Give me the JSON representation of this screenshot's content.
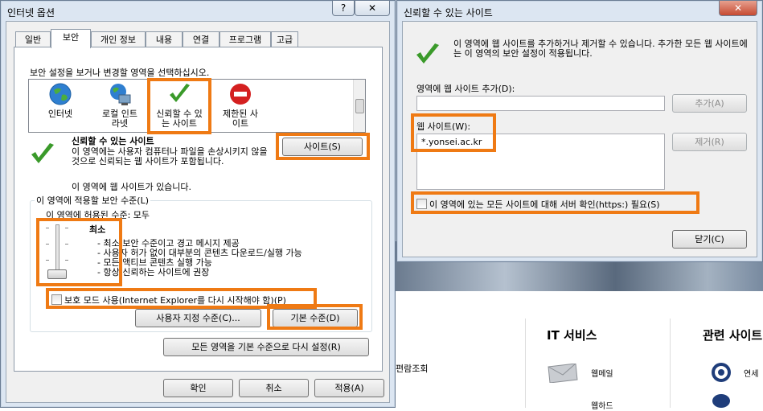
{
  "dialog1": {
    "title": "인터넷 옵션",
    "help_btn": "?",
    "close_btn": "✕",
    "tabs": [
      "일반",
      "보안",
      "개인 정보",
      "내용",
      "연결",
      "프로그램",
      "고급"
    ],
    "instruction": "보안 설정을 보거나 변경할 영역을 선택하십시오.",
    "zones": [
      {
        "label": "인터넷",
        "icon": "globe-icon"
      },
      {
        "label": "로컬 인트라넷",
        "icon": "intranet-icon"
      },
      {
        "label": "신뢰할 수 있는 사이트",
        "icon": "checkmark-icon"
      },
      {
        "label": "제한된 사이트",
        "icon": "restricted-icon"
      }
    ],
    "zone_title": "신뢰할 수 있는 사이트",
    "zone_desc": "이 영역에는 사용자 컴퓨터나 파일을 손상시키지 않을 것으로 신뢰되는 웹 사이트가 포함됩니다.",
    "zone_note": "이 영역에 웹 사이트가 있습니다.",
    "sites_btn": "사이트(S)",
    "security_level_group": "이 영역에 적용할 보안 수준(L)",
    "allowed_level": "이 영역에 허용된 수준: 모두",
    "level_name": "최소",
    "level_desc": [
      "- 최소 보안 수준이고 경고 메시지 제공",
      "- 사용자 허가 없이 대부분의 콘텐츠 다운로드/실행 가능",
      "- 모든 액티브 콘텐츠 실행 가능",
      "- 항상 신뢰하는 사이트에 권장"
    ],
    "protected_mode": "보호 모드 사용(Internet Explorer를 다시 시작해야 함)(P)",
    "custom_level_btn": "사용자 지정 수준(C)...",
    "default_level_btn": "기본 수준(D)",
    "reset_all_btn": "모든 영역을 기본 수준으로 다시 설정(R)",
    "ok_btn": "확인",
    "cancel_btn": "취소",
    "apply_btn": "적용(A)"
  },
  "dialog2": {
    "title": "신뢰할 수 있는 사이트",
    "close_btn": "✕",
    "description": "이 영역에 웹 사이트를 추가하거나 제거할 수 있습니다. 추가한 모든 웹 사이트에는 이 영역의 보안 설정이 적용됩니다.",
    "add_label": "영역에 웹 사이트 추가(D):",
    "add_value": "",
    "add_btn": "추가(A)",
    "websites_label": "웹 사이트(W):",
    "websites": [
      "*.yonsei.ac.kr"
    ],
    "remove_btn": "제거(R)",
    "https_check": "이 영역에 있는 모든 사이트에 대해 서버 확인(https:) 필요(S)",
    "close_dialog_btn": "닫기(C)"
  },
  "background": {
    "left_link": "편람조회",
    "it_services_title": "IT 서비스",
    "related_sites_title": "관련 사이트",
    "webmail_label": "웹메일",
    "partial_label": "웹하드",
    "partial_label2": "연세"
  },
  "colors": {
    "highlight": "#ef7a14",
    "dialog_frame": "#dce6f2",
    "check_green": "#3a9a2a",
    "restricted_red": "#d42020"
  }
}
